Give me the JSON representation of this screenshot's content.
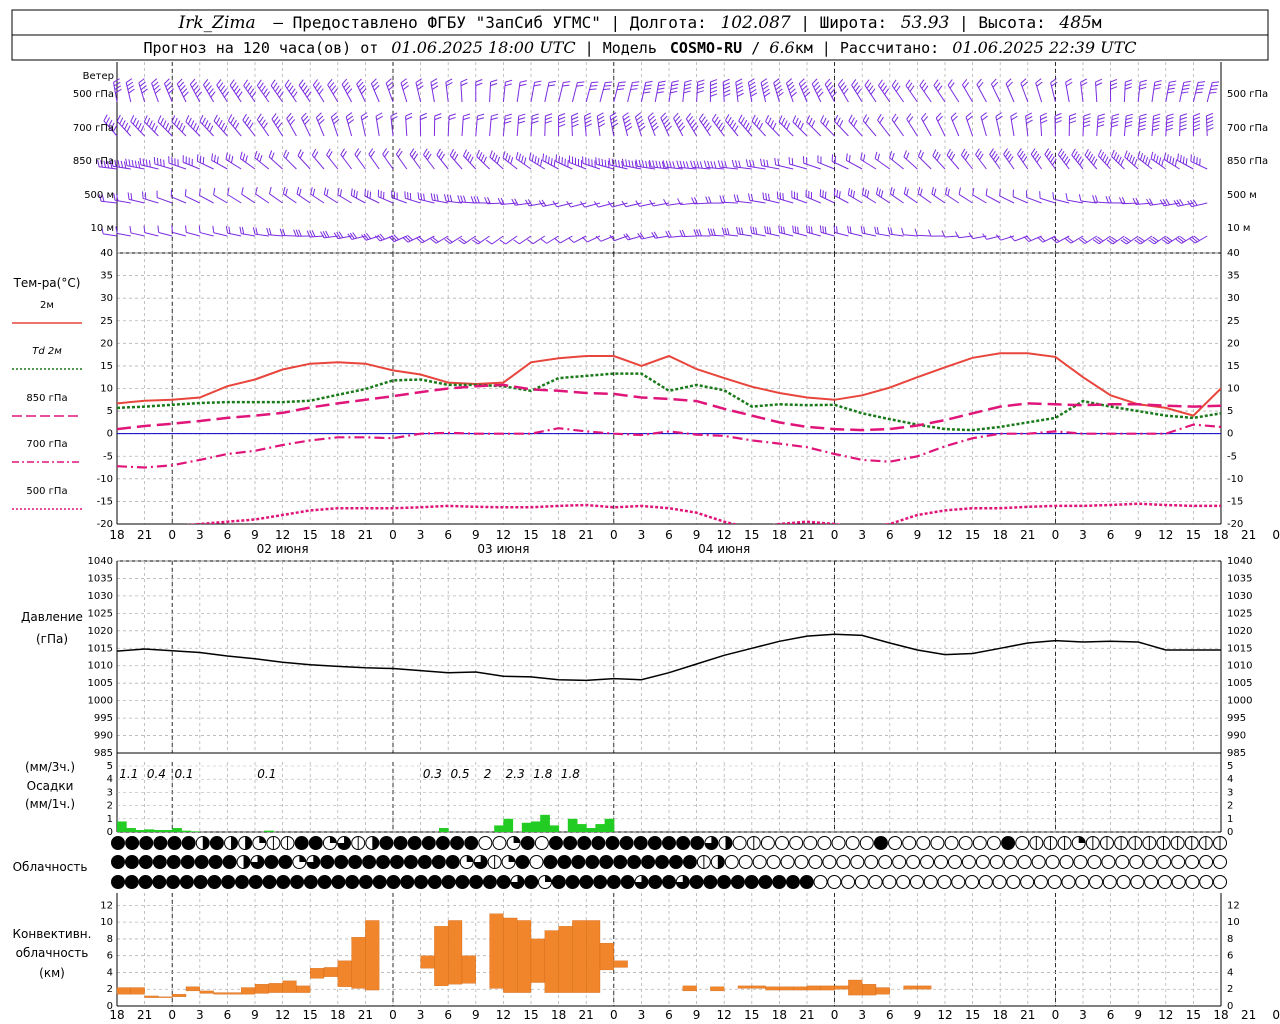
{
  "header": {
    "station": "Irk_Zima",
    "provided_by": "Предоставлено ФГБУ \"ЗапСиб УГМС\"",
    "lon_label": "Долгота:",
    "lon_value": "102.087",
    "lat_label": "Широта:",
    "lat_value": "53.93",
    "alt_label": "Высота:",
    "alt_value": "485",
    "alt_unit": "м",
    "forecast_label": "Прогноз на 120 часа(ов) от",
    "forecast_time": "01.06.2025 18:00 UTC",
    "model_label": "Модель",
    "model_name": "COSMO-RU",
    "model_res": "6.6",
    "model_res_unit": "км",
    "calc_label": "Рассчитано:",
    "calc_time": "01.06.2025 22:39 UTC"
  },
  "colors": {
    "wind": "#7b2be0",
    "t2m": "#e8453c",
    "td2m": "#1a7a1a",
    "t850": "#e0157a",
    "t700": "#e0157a",
    "t500": "#e0157a",
    "pressure": "#000000",
    "precip": "#22cc22",
    "conv": "#f0852b",
    "zero_line": "#0000cc"
  },
  "time_axis": {
    "hour_labels": [
      "18",
      "21",
      "0",
      "3",
      "6",
      "9",
      "12",
      "15",
      "18",
      "21",
      "0",
      "3",
      "6",
      "9",
      "12",
      "15",
      "18",
      "21",
      "0",
      "3",
      "6",
      "9",
      "12",
      "15",
      "18",
      "21",
      "0",
      "3",
      "6",
      "9",
      "12",
      "15",
      "18",
      "21",
      "0",
      "3",
      "6",
      "9",
      "12",
      "15",
      "18",
      "21",
      "0"
    ],
    "day_labels": [
      "02 июня",
      "03 июня",
      "04 июня"
    ]
  },
  "wind_panel": {
    "title": "Ветер",
    "levels": [
      "500 гПа",
      "700 гПа",
      "850 гПа",
      "500 м",
      "10 м"
    ]
  },
  "chart_data": [
    {
      "type": "line",
      "title": "Тем-ра(°C)",
      "ylim": [
        -20,
        40
      ],
      "yticks": [
        -20,
        -15,
        -10,
        -5,
        0,
        5,
        10,
        15,
        20,
        25,
        30,
        35,
        40
      ],
      "legend": [
        "2м",
        "Td 2м",
        "850 гПа",
        "700 гПа",
        "500 гПа"
      ],
      "series": [
        {
          "name": "2м",
          "key": "t2m",
          "x": [
            0,
            3,
            6,
            9,
            12,
            15,
            18,
            21,
            24,
            27,
            30,
            33,
            36,
            39,
            42,
            45,
            48,
            51,
            54,
            57,
            60,
            63,
            66,
            69,
            72,
            75,
            78,
            81,
            84,
            87,
            90,
            93,
            96,
            99,
            102,
            105,
            108,
            111,
            114,
            117,
            120
          ],
          "values": [
            6.7,
            7.3,
            7.5,
            8.0,
            10.5,
            12.0,
            14.2,
            15.5,
            15.8,
            15.5,
            14.0,
            13.1,
            11.3,
            11.0,
            11.3,
            15.8,
            16.7,
            17.2,
            17.2,
            15.0,
            17.2,
            14.3,
            12.3,
            10.4,
            9.0,
            8.0,
            7.5,
            8.5,
            10.2,
            12.5,
            14.7,
            16.8,
            17.8,
            17.8,
            17.0,
            12.5,
            8.5,
            6.5,
            5.7,
            4.0,
            10.0
          ]
        },
        {
          "name": "Td 2м",
          "key": "td2m",
          "x": [
            0,
            3,
            6,
            9,
            12,
            15,
            18,
            21,
            24,
            27,
            30,
            33,
            36,
            39,
            42,
            45,
            48,
            51,
            54,
            57,
            60,
            63,
            66,
            69,
            72,
            75,
            78,
            81,
            84,
            87,
            90,
            93,
            96,
            99,
            102,
            105,
            108,
            111,
            114,
            117,
            120
          ],
          "values": [
            5.7,
            6.0,
            6.4,
            6.8,
            7.0,
            7.0,
            7.0,
            7.3,
            8.6,
            9.9,
            11.8,
            12.0,
            10.8,
            10.8,
            10.5,
            9.5,
            12.3,
            12.8,
            13.3,
            13.3,
            9.5,
            10.8,
            9.6,
            6.0,
            6.5,
            6.3,
            6.4,
            4.5,
            3.2,
            2.0,
            1.0,
            0.8,
            1.5,
            2.5,
            3.5,
            7.2,
            6.0,
            5.0,
            4.0,
            3.5,
            4.5
          ]
        },
        {
          "name": "850 гПа",
          "key": "t850",
          "x": [
            0,
            3,
            6,
            9,
            12,
            15,
            18,
            21,
            24,
            27,
            30,
            33,
            36,
            39,
            42,
            45,
            48,
            51,
            54,
            57,
            60,
            63,
            66,
            69,
            72,
            75,
            78,
            81,
            84,
            87,
            90,
            93,
            96,
            99,
            102,
            105,
            108,
            111,
            114,
            117,
            120
          ],
          "values": [
            1.0,
            1.7,
            2.2,
            2.8,
            3.5,
            4.0,
            4.6,
            5.8,
            6.7,
            7.5,
            8.3,
            9.2,
            10.0,
            10.5,
            10.8,
            9.8,
            9.5,
            9.0,
            8.8,
            8.0,
            7.7,
            7.2,
            5.5,
            4.0,
            2.5,
            1.5,
            1.0,
            0.8,
            1.0,
            1.8,
            3.0,
            4.5,
            6.0,
            6.7,
            6.5,
            6.3,
            6.5,
            6.5,
            6.2,
            6.0,
            6.2
          ]
        },
        {
          "name": "700 гПа",
          "key": "t700",
          "x": [
            0,
            3,
            6,
            9,
            12,
            15,
            18,
            21,
            24,
            27,
            30,
            33,
            36,
            39,
            42,
            45,
            48,
            51,
            54,
            57,
            60,
            63,
            66,
            69,
            72,
            75,
            78,
            81,
            84,
            87,
            90,
            93,
            96,
            99,
            102,
            105,
            108,
            111,
            114,
            117,
            120
          ],
          "values": [
            -7.2,
            -7.5,
            -7.0,
            -5.8,
            -4.5,
            -3.8,
            -2.5,
            -1.5,
            -0.8,
            -0.8,
            -1.0,
            0.0,
            0.2,
            0.0,
            0.0,
            0.0,
            1.2,
            0.5,
            0.0,
            -0.3,
            0.5,
            -0.2,
            -0.5,
            -1.5,
            -2.2,
            -3.0,
            -4.5,
            -5.8,
            -6.2,
            -5.0,
            -2.8,
            -1.0,
            0.0,
            0.0,
            0.5,
            0.0,
            0.0,
            0.0,
            0.0,
            2.0,
            1.5
          ]
        },
        {
          "name": "500 гПа",
          "key": "t500",
          "x": [
            0,
            3,
            6,
            9,
            12,
            15,
            18,
            21,
            24,
            27,
            30,
            33,
            36,
            39,
            42,
            45,
            48,
            51,
            54,
            57,
            60,
            63,
            66,
            69,
            72,
            75,
            78,
            81,
            84,
            87,
            90,
            93,
            96,
            99,
            102,
            105,
            108,
            111,
            114,
            117,
            120
          ],
          "values": [
            -22,
            -21,
            -20.5,
            -20,
            -19.5,
            -19,
            -18,
            -17,
            -16.5,
            -16.5,
            -16.5,
            -16.3,
            -16.0,
            -16.2,
            -16.3,
            -16.3,
            -16.0,
            -15.8,
            -16.3,
            -16.0,
            -16.5,
            -17.5,
            -19.5,
            -21,
            -20,
            -19.5,
            -20,
            -21,
            -20,
            -18,
            -17,
            -16.5,
            -16.5,
            -16.2,
            -16.0,
            -16.0,
            -15.8,
            -15.5,
            -15.8,
            -16.0,
            -16.0
          ]
        }
      ]
    },
    {
      "type": "line",
      "title": "Давление",
      "ylabel": "(гПа)",
      "ylim": [
        985,
        1040
      ],
      "yticks": [
        985,
        990,
        995,
        1000,
        1005,
        1010,
        1015,
        1020,
        1025,
        1030,
        1035,
        1040
      ],
      "series": [
        {
          "name": "Давление",
          "key": "pressure",
          "x": [
            0,
            3,
            6,
            9,
            12,
            15,
            18,
            21,
            24,
            27,
            30,
            33,
            36,
            39,
            42,
            45,
            48,
            51,
            54,
            57,
            60,
            63,
            66,
            69,
            72,
            75,
            78,
            81,
            84,
            87,
            90,
            93,
            96,
            99,
            102,
            105,
            108,
            111,
            114,
            117,
            120
          ],
          "values": [
            1014.2,
            1014.8,
            1014.3,
            1013.8,
            1012.8,
            1012.0,
            1011.0,
            1010.3,
            1009.8,
            1009.4,
            1009.2,
            1008.6,
            1008.0,
            1008.2,
            1007.0,
            1006.8,
            1006.0,
            1005.8,
            1006.3,
            1006.0,
            1008.0,
            1010.5,
            1013.0,
            1015.0,
            1017.0,
            1018.5,
            1019.0,
            1018.7,
            1016.5,
            1014.5,
            1013.2,
            1013.5,
            1015.0,
            1016.5,
            1017.2,
            1016.8,
            1017.0,
            1016.8,
            1014.5,
            1014.5,
            1014.5
          ]
        }
      ]
    },
    {
      "type": "bar",
      "title": "Осадки",
      "ylabel_top": "(мм/3ч.)",
      "ylabel_bottom": "(мм/1ч.)",
      "ylim": [
        0,
        5
      ],
      "yticks": [
        0,
        1,
        2,
        3,
        4,
        5
      ],
      "sums": [
        {
          "x": 1.5,
          "label": "1.1"
        },
        {
          "x": 4.5,
          "label": "0.4"
        },
        {
          "x": 7.5,
          "label": "0.1"
        },
        {
          "x": 16.5,
          "label": "0.1"
        },
        {
          "x": 34.5,
          "label": "0.3"
        },
        {
          "x": 37.5,
          "label": "0.5"
        },
        {
          "x": 40.5,
          "label": "2"
        },
        {
          "x": 43.5,
          "label": "2.3"
        },
        {
          "x": 46.5,
          "label": "1.8"
        },
        {
          "x": 49.5,
          "label": "1.8"
        }
      ],
      "hours": [
        0,
        1,
        2,
        3,
        4,
        5,
        6,
        7,
        8,
        9,
        10,
        11,
        12,
        13,
        14,
        15,
        16,
        17,
        18,
        19,
        20,
        21,
        22,
        23,
        24,
        25,
        26,
        27,
        28,
        29,
        30,
        31,
        32,
        33,
        34,
        35,
        36,
        37,
        38,
        39,
        40,
        41,
        42,
        43,
        44,
        45,
        46,
        47,
        48,
        49,
        50
      ],
      "values": [
        0.8,
        0.3,
        0.15,
        0.2,
        0.15,
        0.15,
        0.3,
        0.1,
        0.05,
        0,
        0,
        0,
        0,
        0,
        0,
        0,
        0.1,
        0,
        0,
        0,
        0,
        0,
        0,
        0,
        0,
        0,
        0,
        0,
        0,
        0,
        0,
        0,
        0,
        0,
        0,
        0.3,
        0,
        0,
        0,
        0,
        0,
        0.5,
        1.0,
        0,
        0.7,
        0.8,
        1.3,
        0.5,
        0,
        1.0,
        0.6,
        0.3,
        0.6,
        1.0
      ]
    },
    {
      "type": "bar",
      "title": "Конвективн. облачность",
      "ylabel": "(км)",
      "ylim": [
        0,
        13
      ],
      "yticks": [
        0,
        2,
        4,
        6,
        8,
        10,
        12
      ],
      "bars": [
        [
          0,
          1,
          2.2,
          1.4
        ],
        [
          1,
          2,
          2.2,
          1.4
        ],
        [
          2,
          3,
          1.2,
          1.0
        ],
        [
          3,
          4,
          1.1,
          1.0
        ],
        [
          4,
          5,
          1.4,
          1.1
        ],
        [
          5,
          6,
          2.3,
          1.8
        ],
        [
          6,
          7,
          1.8,
          1.5
        ],
        [
          7,
          8,
          1.6,
          1.4
        ],
        [
          8,
          9,
          1.6,
          1.4
        ],
        [
          9,
          10,
          2.2,
          1.4
        ],
        [
          10,
          11,
          2.6,
          1.5
        ],
        [
          11,
          12,
          2.7,
          1.6
        ],
        [
          12,
          13,
          3.0,
          1.6
        ],
        [
          13,
          14,
          2.4,
          1.6
        ],
        [
          14,
          15,
          4.5,
          3.3
        ],
        [
          15,
          16,
          4.6,
          3.5
        ],
        [
          16,
          17,
          5.4,
          2.3
        ],
        [
          17,
          18,
          8.2,
          2.1
        ],
        [
          18,
          19,
          10.2,
          1.9
        ],
        [
          22,
          23,
          6.0,
          4.5
        ],
        [
          23,
          24,
          9.5,
          2.4
        ],
        [
          24,
          25,
          10.2,
          2.6
        ],
        [
          25,
          26,
          6.0,
          2.7
        ],
        [
          27,
          28,
          11.0,
          2.1
        ],
        [
          28,
          29,
          10.5,
          1.6
        ],
        [
          29,
          30,
          10.2,
          1.6
        ],
        [
          30,
          31,
          8.0,
          2.8
        ],
        [
          31,
          32,
          9.0,
          1.6
        ],
        [
          32,
          33,
          9.5,
          1.6
        ],
        [
          33,
          34,
          10.2,
          1.6
        ],
        [
          34,
          35,
          10.2,
          1.6
        ],
        [
          35,
          36,
          7.5,
          4.3
        ],
        [
          36,
          37,
          5.4,
          4.6
        ],
        [
          41,
          42,
          2.4,
          1.8
        ],
        [
          43,
          44,
          2.3,
          1.8
        ],
        [
          45,
          46,
          2.4,
          2.1
        ],
        [
          46,
          47,
          2.4,
          2.1
        ],
        [
          47,
          48,
          2.3,
          1.9
        ],
        [
          48,
          49,
          2.3,
          1.9
        ],
        [
          49,
          50,
          2.3,
          1.9
        ],
        [
          50,
          51,
          2.4,
          1.9
        ],
        [
          51,
          52,
          2.4,
          1.9
        ],
        [
          52,
          53,
          2.4,
          2.0
        ],
        [
          53,
          54,
          3.1,
          1.3
        ],
        [
          54,
          55,
          2.6,
          1.3
        ],
        [
          55,
          56,
          2.2,
          1.4
        ],
        [
          57,
          58,
          2.4,
          2.0
        ],
        [
          58,
          59,
          2.4,
          2.0
        ]
      ]
    }
  ],
  "cloud_panel": {
    "title": "Облачность",
    "rows": [
      "FFFFFFDFDDPUUFFPQUDFFFFFFFOOPFOFFFFFFFFFFFQDOUOOOOOOOOFOOOOOOOOFOUUUPUUUUUUUUUU",
      "FFFFFFFFFDQFFPQFFFFFFFFFFPQUPFOFFFFFFFFFFFUDOOOOOOOOOOOOOOOOOOOOOOOOOOOOOOOOOOOO",
      "FFFFFFFFFFFFFFFFFFFFFFFFFFFFFQFPFFFFFFQFFQFFFFFFFFFOOOOOOOOOOOOOOOOOOOOOOOOOOOOOO"
    ]
  }
}
